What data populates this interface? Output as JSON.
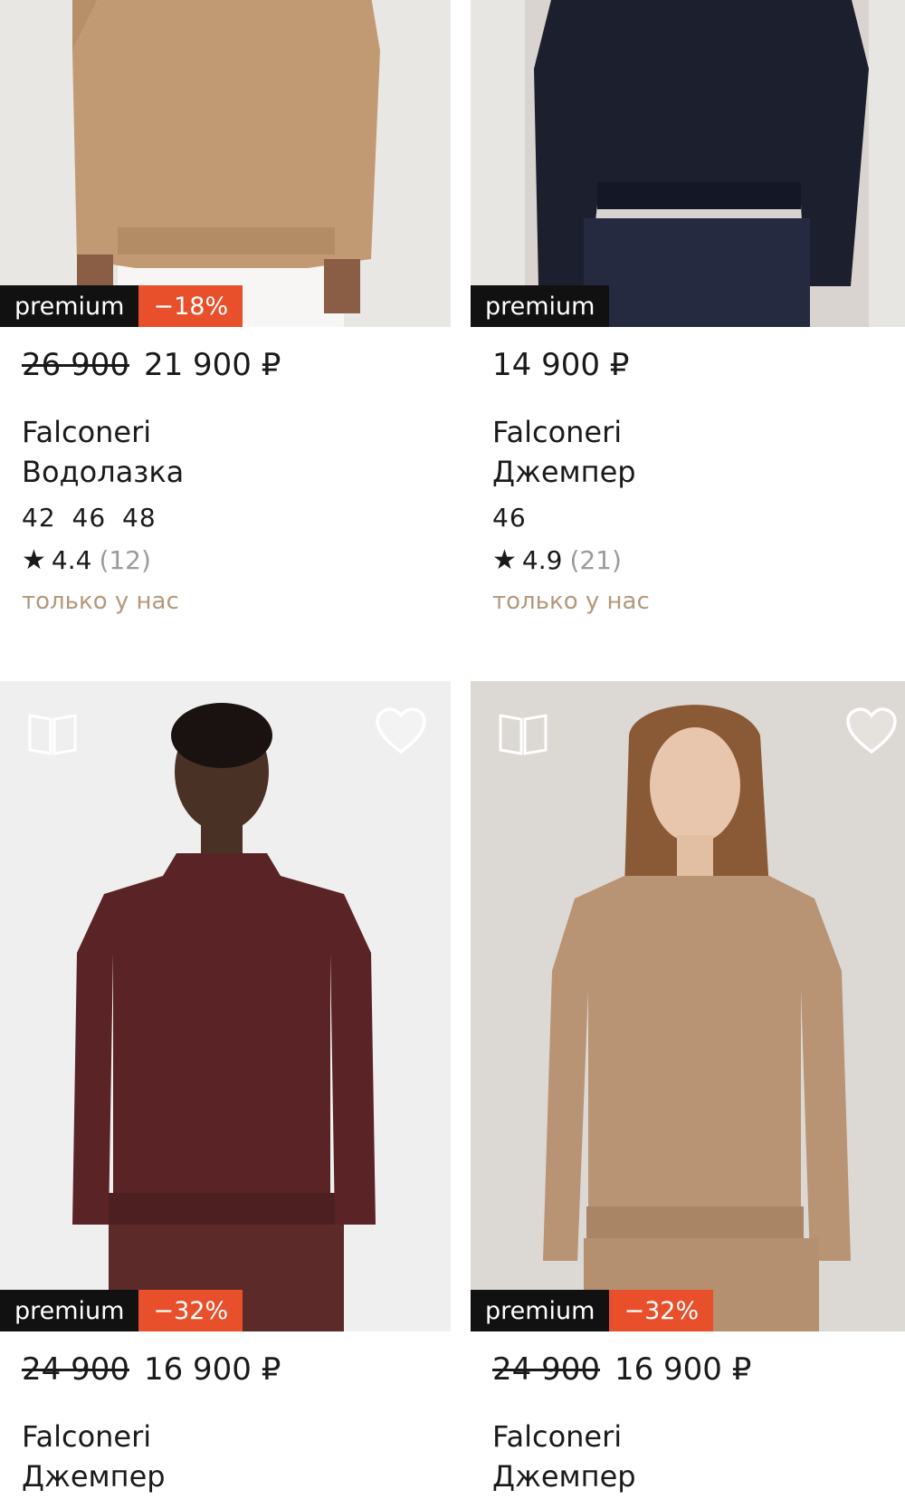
{
  "products": [
    {
      "badge": "premium",
      "discount": "−18%",
      "old_price": "26 900",
      "price": "21 900 ₽",
      "brand": "Falconeri",
      "name": "Водолазка",
      "sizes": "42  46  48",
      "rating": "4.4",
      "reviews": "(12)",
      "exclusive": "только у нас",
      "image_color": "#c19a74"
    },
    {
      "badge": "premium",
      "price": "14 900 ₽",
      "brand": "Falconeri",
      "name": "Джемпер",
      "sizes": "46",
      "rating": "4.9",
      "reviews": "(21)",
      "exclusive": "только у нас",
      "image_color": "#1b1f2e"
    },
    {
      "badge": "premium",
      "discount": "−32%",
      "old_price": "24 900",
      "price": "16 900 ₽",
      "brand": "Falconeri",
      "name": "Джемпер",
      "image_color": "#5a2426",
      "icons": {
        "compare": "compare-icon",
        "favorite": "heart-icon"
      }
    },
    {
      "badge": "premium",
      "discount": "−32%",
      "old_price": "24 900",
      "price": "16 900 ₽",
      "brand": "Falconeri",
      "name": "Джемпер",
      "image_color": "#b89374",
      "icons": {
        "compare": "compare-icon",
        "favorite": "heart-icon"
      }
    }
  ],
  "colors": {
    "sale": "#e8502c",
    "premium": "#111111",
    "exclusive": "#b4987a"
  }
}
